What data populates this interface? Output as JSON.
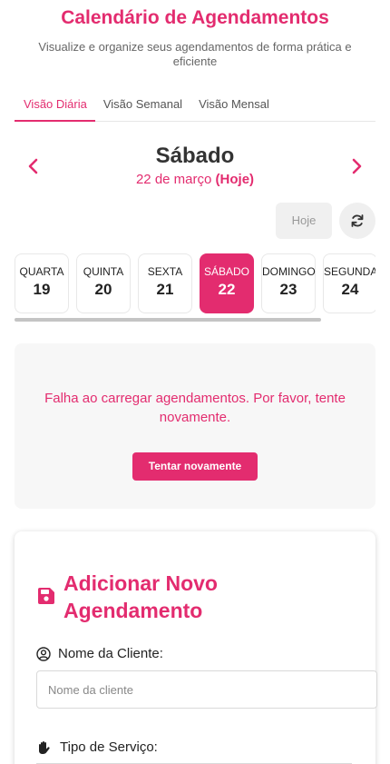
{
  "header": {
    "title": "Calendário de Agendamentos",
    "subtitle": "Visualize e organize seus agendamentos de forma prática e eficiente"
  },
  "tabs": [
    {
      "label": "Visão Diária",
      "active": true
    },
    {
      "label": "Visão Semanal",
      "active": false
    },
    {
      "label": "Visão Mensal",
      "active": false
    }
  ],
  "day_nav": {
    "day_name": "Sábado",
    "date": "22 de março",
    "today_tag": "(Hoje)"
  },
  "controls": {
    "today_button": "Hoje",
    "refresh_icon": "refresh-icon"
  },
  "days": [
    {
      "weekday": "QUARTA",
      "number": "19",
      "selected": false
    },
    {
      "weekday": "QUINTA",
      "number": "20",
      "selected": false
    },
    {
      "weekday": "SEXTA",
      "number": "21",
      "selected": false
    },
    {
      "weekday": "SÁBADO",
      "number": "22",
      "selected": true
    },
    {
      "weekday": "DOMINGO",
      "number": "23",
      "selected": false
    },
    {
      "weekday": "SEGUNDA",
      "number": "24",
      "selected": false
    }
  ],
  "error": {
    "message": "Falha ao carregar agendamentos. Por favor, tente novamente.",
    "retry_button": "Tentar novamente"
  },
  "form": {
    "title": "Adicionar Novo Agendamento",
    "name_label": "Nome da Cliente:",
    "name_placeholder": "Nome da cliente",
    "name_value": "",
    "service_label": "Tipo de Serviço:"
  },
  "colors": {
    "accent": "#e32c6f",
    "muted_button": "#f0f0f0",
    "error_bg": "#f7f7f7"
  }
}
